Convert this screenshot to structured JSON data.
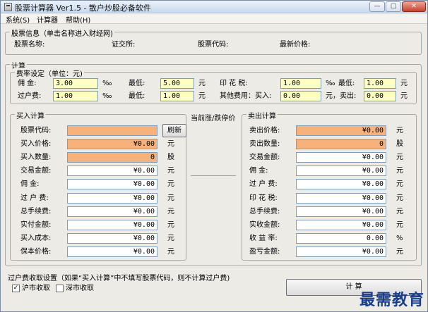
{
  "window": {
    "title": "股票计算器 Ver1.5 - 散户炒股必备软件",
    "buttons": [
      "—",
      "□",
      "✕"
    ]
  },
  "menu": [
    {
      "label": "系统(S)"
    },
    {
      "label": "计算器"
    },
    {
      "label": "帮助(H)"
    }
  ],
  "stock_info": {
    "title": "股票信息（单击名称进入财经网)",
    "name_label": "股票名称:",
    "exchange_label": "证交所:",
    "code_label": "股票代码:",
    "latest_price_label": "最新价格:"
  },
  "calc": {
    "title": "计算",
    "rates": {
      "title": "费率设定（单位：元)",
      "commission_label": "佣    金:",
      "commission_value": "3.00",
      "percent": "‰",
      "min_label": "最低:",
      "commission_min": "5.00",
      "yuan": "元",
      "stamp_label": "印 花 税:",
      "stamp_value": "1.00",
      "stamp_min": "1.00",
      "transfer_label": "过户费:",
      "transfer_value": "1.00",
      "transfer_min": "1.00",
      "other_label": "其他费用：买入:",
      "other_buy": "0.00",
      "sell_label": "元，卖出:",
      "other_sell": "0.00"
    },
    "middle_label": "当前涨/跌停价",
    "buy": {
      "title": "买入计算",
      "refresh_button": "刷新",
      "rows": [
        {
          "label": "股票代码:",
          "value": "",
          "style": "orange",
          "unit": ""
        },
        {
          "label": "买入价格:",
          "value": "¥0.00",
          "style": "orange",
          "unit": "元"
        },
        {
          "label": "买入数量:",
          "value": "0",
          "style": "orange",
          "unit": "股"
        },
        {
          "label": "交易金额:",
          "value": "¥0.00",
          "style": "white",
          "unit": "元"
        },
        {
          "label": "佣    金:",
          "value": "¥0.00",
          "style": "white",
          "unit": "元"
        },
        {
          "label": "过 户 费:",
          "value": "¥0.00",
          "style": "white",
          "unit": "元"
        },
        {
          "label": "总手续费:",
          "value": "¥0.00",
          "style": "white",
          "unit": "元"
        },
        {
          "label": "实付金额:",
          "value": "¥0.00",
          "style": "white",
          "unit": "元"
        },
        {
          "label": "买入成本:",
          "value": "¥0.00",
          "style": "white",
          "unit": "元"
        },
        {
          "label": "保本价格:",
          "value": "¥0.00",
          "style": "white",
          "unit": "元"
        }
      ]
    },
    "sell": {
      "title": "卖出计算",
      "rows": [
        {
          "label": "卖出价格:",
          "value": "¥0.00",
          "style": "orange",
          "unit": "元"
        },
        {
          "label": "卖出数量:",
          "value": "0",
          "style": "orange",
          "unit": "股"
        },
        {
          "label": "交易金额:",
          "value": "¥0.00",
          "style": "white",
          "unit": "元"
        },
        {
          "label": "佣    金:",
          "value": "¥0.00",
          "style": "white",
          "unit": "元"
        },
        {
          "label": "过 户 费:",
          "value": "¥0.00",
          "style": "white",
          "unit": "元"
        },
        {
          "label": "印 花 税:",
          "value": "¥0.00",
          "style": "white",
          "unit": "元"
        },
        {
          "label": "总手续费:",
          "value": "¥0.00",
          "style": "white",
          "unit": "元"
        },
        {
          "label": "实收金额:",
          "value": "¥0.00",
          "style": "white",
          "unit": "元"
        },
        {
          "label": "收 益 率:",
          "value": "0.00",
          "style": "white",
          "unit": "%"
        },
        {
          "label": "盈亏金额:",
          "value": "¥0.00",
          "style": "white",
          "unit": "元"
        }
      ]
    }
  },
  "transfer_settings": {
    "title": "过户费收取设置（如果“买入计算”中不填写股票代码，则不计算过户费)",
    "sh_label": "沪市收取",
    "sh_checked": "✓",
    "sz_label": "深市收取",
    "sz_checked": ""
  },
  "calc_button": "计 算",
  "watermark": "最需教育"
}
